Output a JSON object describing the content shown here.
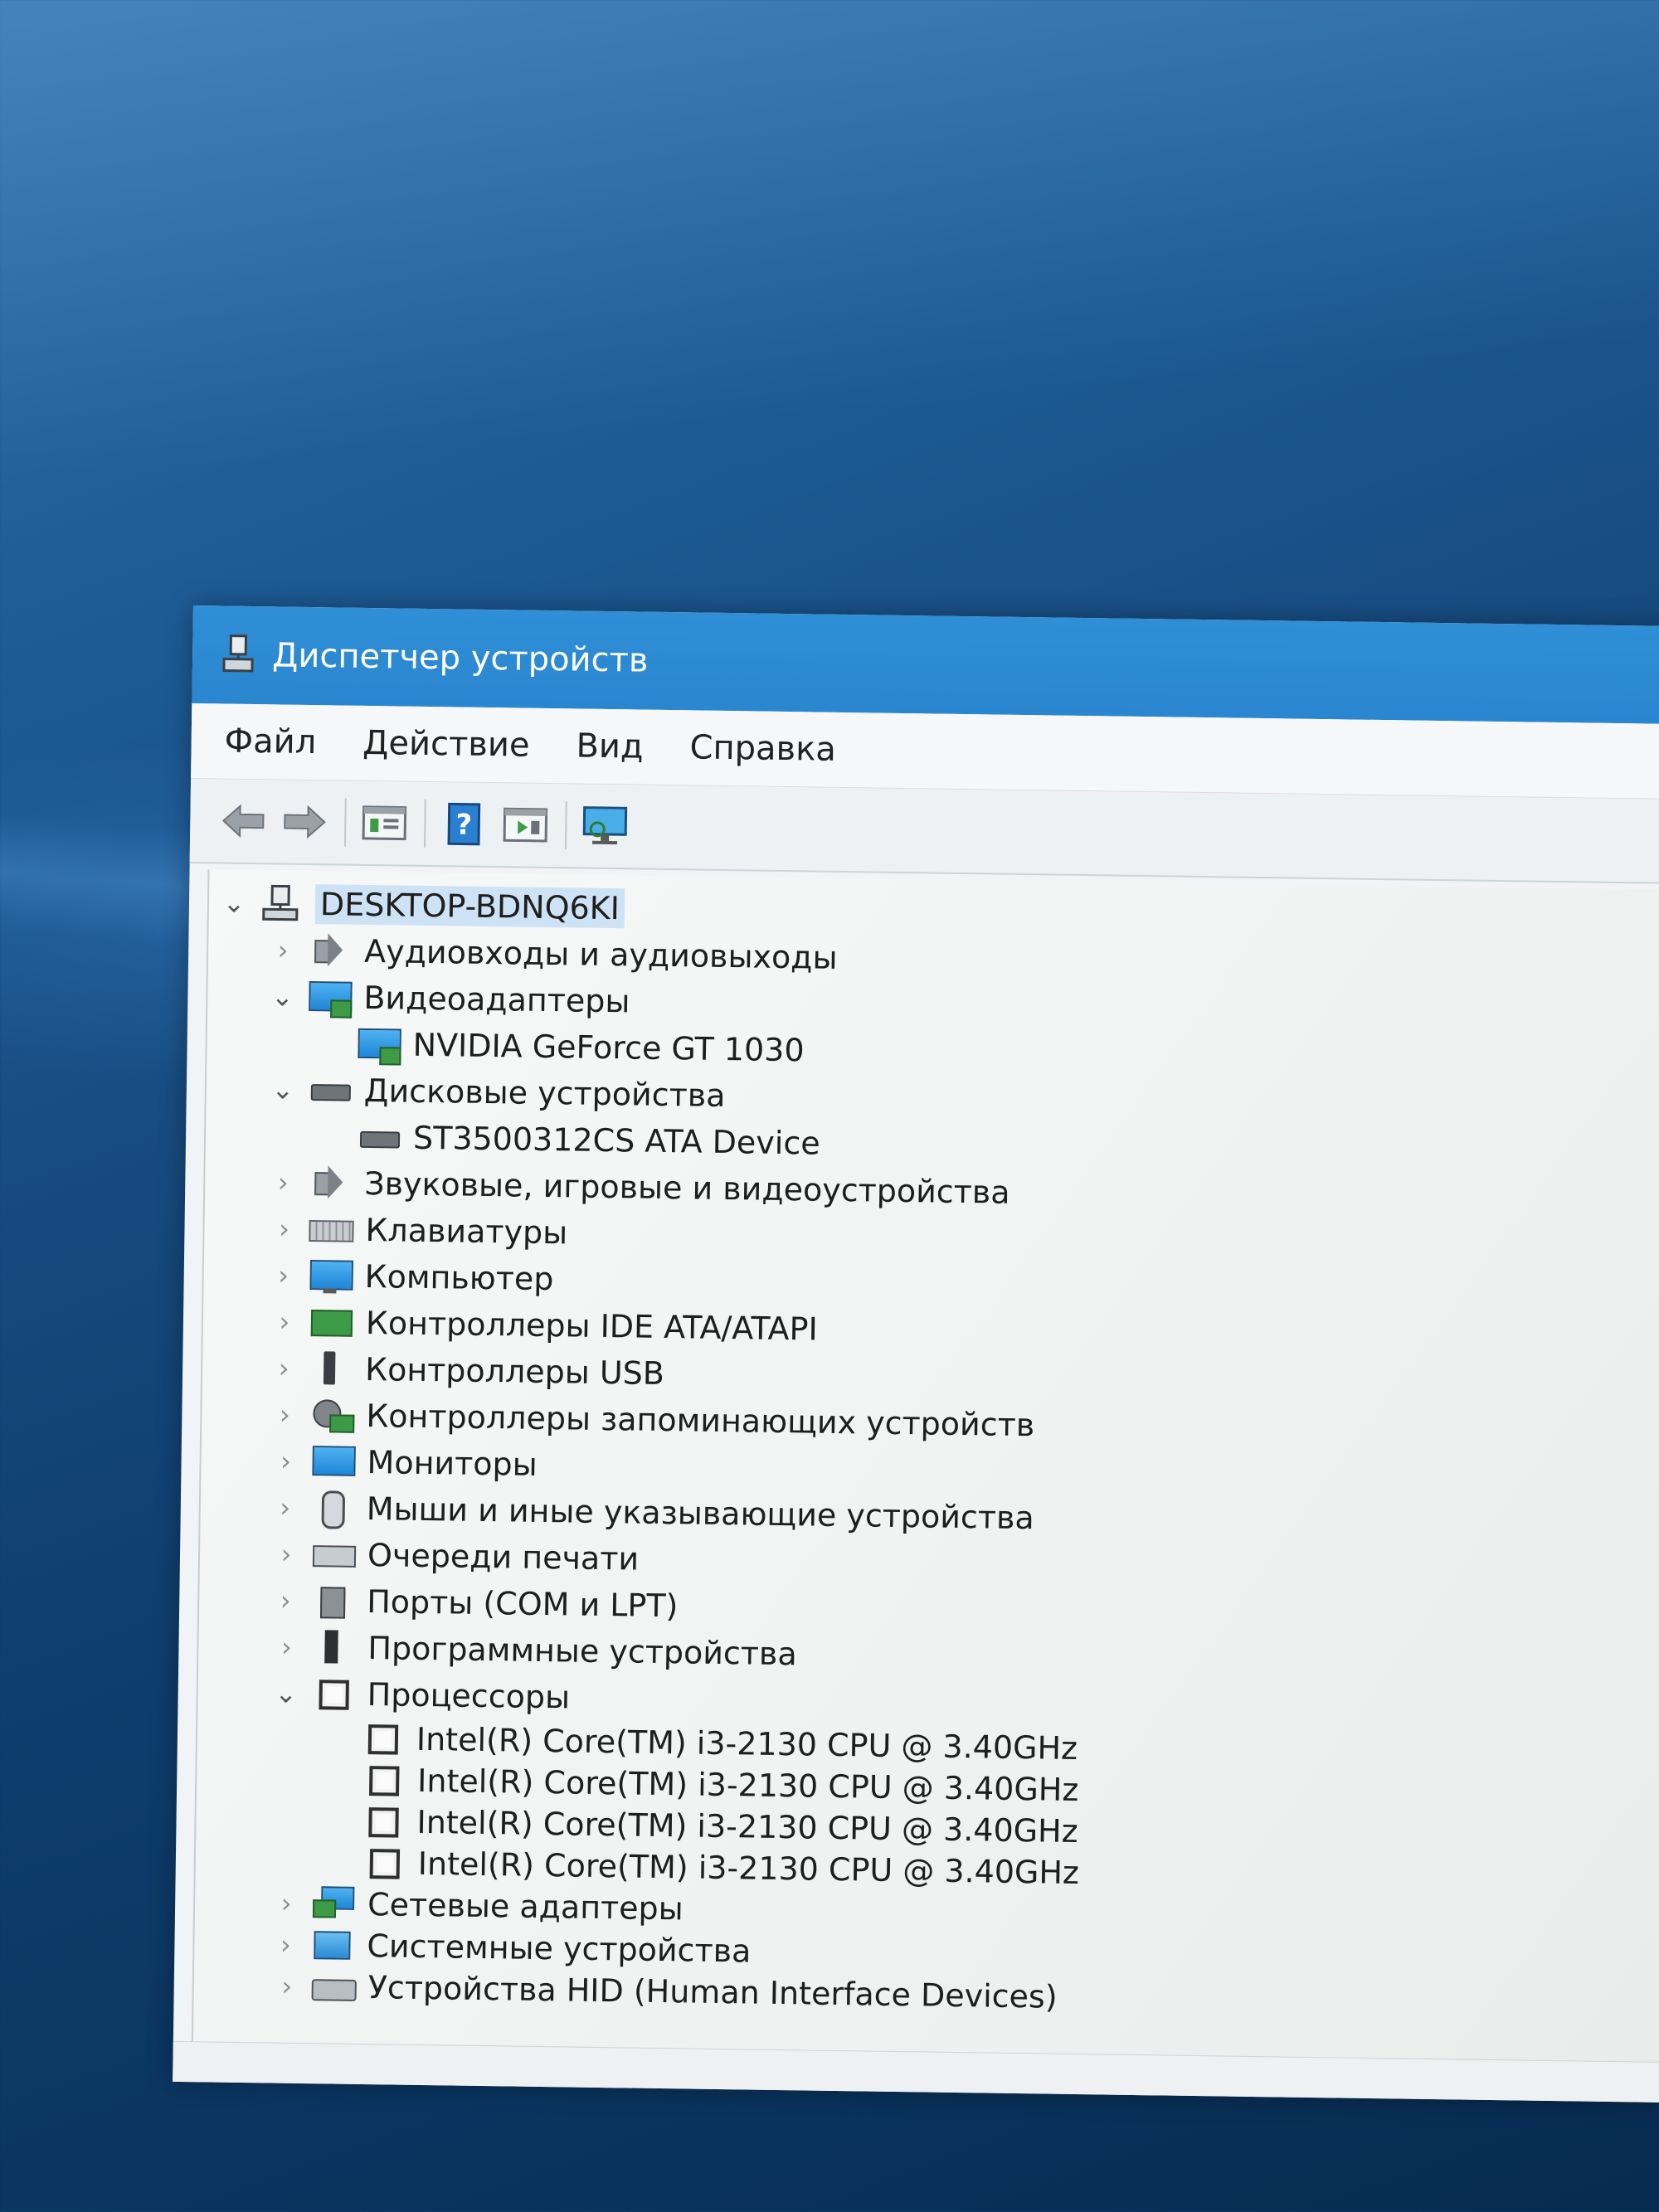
{
  "window": {
    "title": "Диспетчер устройств"
  },
  "menu": [
    "Файл",
    "Действие",
    "Вид",
    "Справка"
  ],
  "toolbar": {
    "back": "back-arrow-icon",
    "forward": "forward-arrow-icon",
    "properties": "properties-icon",
    "help": "help-icon",
    "update": "update-driver-icon",
    "scan": "scan-hardware-icon"
  },
  "tree": {
    "root": "DESKTOP-BDNQ6KI",
    "nodes": [
      {
        "label": "Аудиовходы и аудиовыходы",
        "expanded": false,
        "icon": "speaker-icon"
      },
      {
        "label": "Видеоадаптеры",
        "expanded": true,
        "icon": "display-adapter-icon",
        "children": [
          "NVIDIA GeForce GT 1030"
        ]
      },
      {
        "label": "Дисковые устройства",
        "expanded": true,
        "icon": "disk-drive-icon",
        "children": [
          "ST3500312CS ATA Device"
        ]
      },
      {
        "label": "Звуковые, игровые и видеоустройства",
        "expanded": false,
        "icon": "sound-icon"
      },
      {
        "label": "Клавиатуры",
        "expanded": false,
        "icon": "keyboard-icon"
      },
      {
        "label": "Компьютер",
        "expanded": false,
        "icon": "computer-icon"
      },
      {
        "label": "Контроллеры IDE ATA/ATAPI",
        "expanded": false,
        "icon": "ide-controller-icon"
      },
      {
        "label": "Контроллеры USB",
        "expanded": false,
        "icon": "usb-icon"
      },
      {
        "label": "Контроллеры запоминающих устройств",
        "expanded": false,
        "icon": "storage-controller-icon"
      },
      {
        "label": "Мониторы",
        "expanded": false,
        "icon": "monitor-icon"
      },
      {
        "label": "Мыши и иные указывающие устройства",
        "expanded": false,
        "icon": "mouse-icon"
      },
      {
        "label": "Очереди печати",
        "expanded": false,
        "icon": "printer-icon"
      },
      {
        "label": "Порты (COM и LPT)",
        "expanded": false,
        "icon": "port-icon"
      },
      {
        "label": "Программные устройства",
        "expanded": false,
        "icon": "software-device-icon"
      },
      {
        "label": "Процессоры",
        "expanded": true,
        "icon": "processor-icon",
        "children": [
          "Intel(R) Core(TM) i3-2130 CPU @ 3.40GHz",
          "Intel(R) Core(TM) i3-2130 CPU @ 3.40GHz",
          "Intel(R) Core(TM) i3-2130 CPU @ 3.40GHz",
          "Intel(R) Core(TM) i3-2130 CPU @ 3.40GHz"
        ]
      },
      {
        "label": "Сетевые адаптеры",
        "expanded": false,
        "icon": "network-adapter-icon"
      },
      {
        "label": "Системные устройства",
        "expanded": false,
        "icon": "system-device-icon"
      },
      {
        "label": "Устройства HID (Human Interface Devices)",
        "expanded": false,
        "icon": "hid-icon"
      }
    ]
  },
  "colors": {
    "titlebar": "#2a86cf",
    "selection": "#cde3f5",
    "desktop": "#16497d"
  }
}
